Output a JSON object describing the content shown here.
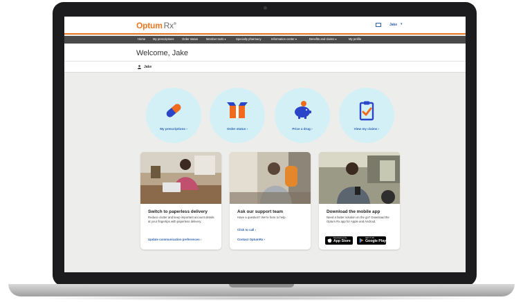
{
  "header": {
    "logo_brand": "Optum",
    "logo_product": "Rx",
    "logo_mark": "®",
    "user_name": "Jake",
    "brand_color": "#e87722",
    "link_color": "#2e61b0"
  },
  "nav": {
    "items": [
      {
        "label": "Home"
      },
      {
        "label": "My prescriptions"
      },
      {
        "label": "Order status"
      },
      {
        "label": "Member tools ▾"
      },
      {
        "label": "Specialty pharmacy"
      },
      {
        "label": "Information center ▾"
      },
      {
        "label": "Benefits and claims ▾"
      },
      {
        "label": "My profile"
      }
    ]
  },
  "welcome": {
    "title": "Welcome, Jake",
    "member_name": "Jake"
  },
  "quick_links": [
    {
      "label": "My prescriptions ›",
      "icon": "pill-icon"
    },
    {
      "label": "Order status ›",
      "icon": "package-icon"
    },
    {
      "label": "Price a drug ›",
      "icon": "piggy-bank-icon"
    },
    {
      "label": "View my claims ›",
      "icon": "clipboard-check-icon"
    }
  ],
  "cards": [
    {
      "title": "Switch to paperless delivery",
      "description": "Reduce clutter and keep important account details at your fingertips with paperless delivery.",
      "links": [
        "Update communication preferences ›"
      ]
    },
    {
      "title": "Ask our support team",
      "description": "Have a question? We're here to help.",
      "links": [
        "Click to call ›",
        "Contact OptumRx ›"
      ]
    },
    {
      "title": "Download the mobile app",
      "description": "Need a faster solution on the go? Download the Optum Rx app for Apple and Android.",
      "badges": [
        {
          "small": "Download on the",
          "big": "App Store"
        },
        {
          "small": "GET IT ON",
          "big": "Google Play"
        }
      ]
    }
  ]
}
